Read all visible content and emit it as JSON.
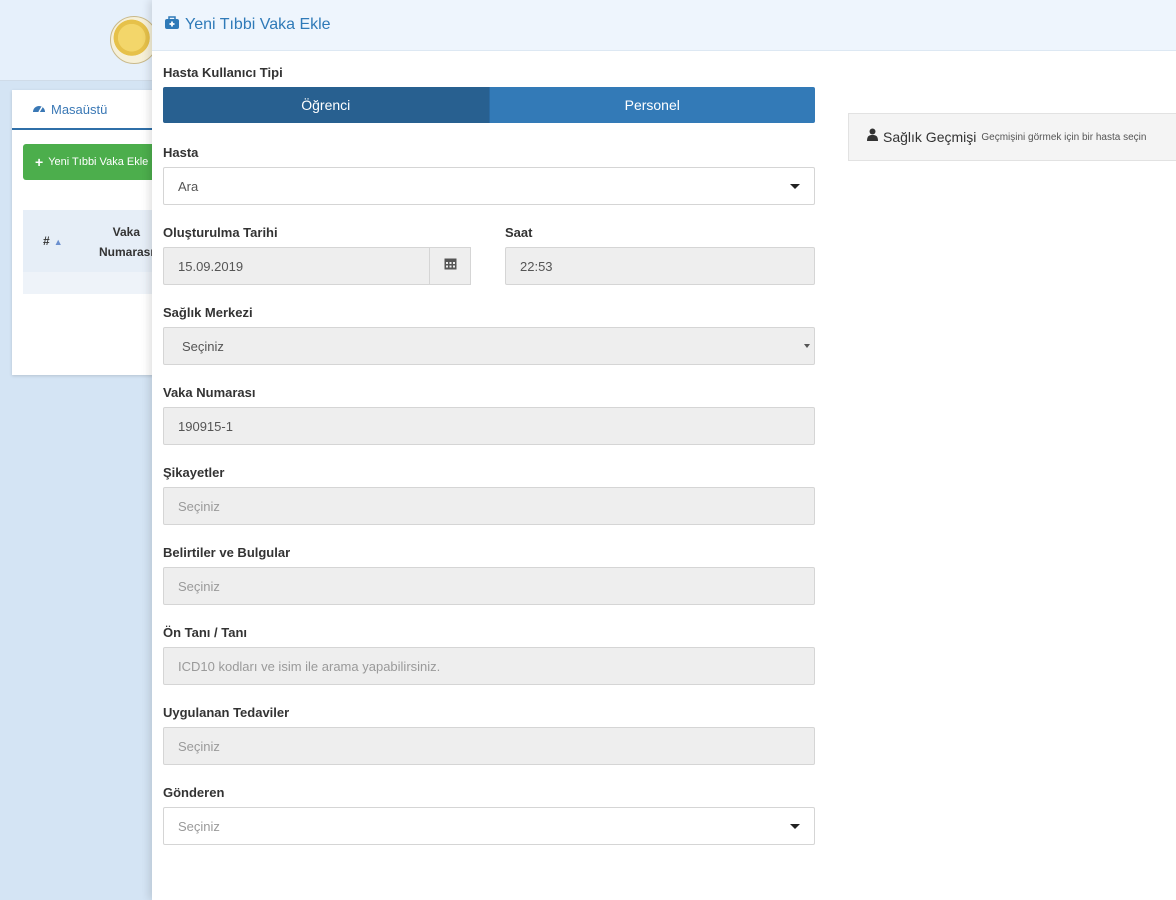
{
  "background": {
    "tab_label": "Masaüstü",
    "add_button_label": "Yeni Tıbbi Vaka Ekle",
    "table": {
      "col_hash": "#",
      "col_vaka_line1": "Vaka",
      "col_vaka_line2": "Numarası"
    }
  },
  "modal": {
    "title": "Yeni Tıbbi Vaka Ekle",
    "user_type": {
      "label": "Hasta Kullanıcı Tipi",
      "options": [
        "Öğrenci",
        "Personel"
      ],
      "selected": "Öğrenci"
    },
    "patient": {
      "label": "Hasta",
      "value": "Ara"
    },
    "created_date": {
      "label": "Oluşturulma Tarihi",
      "value": "15.09.2019"
    },
    "time": {
      "label": "Saat",
      "value": "22:53"
    },
    "health_center": {
      "label": "Sağlık Merkezi",
      "value": "Seçiniz"
    },
    "case_number": {
      "label": "Vaka Numarası",
      "value": "190915-1"
    },
    "complaints": {
      "label": "Şikayetler",
      "placeholder": "Seçiniz"
    },
    "symptoms": {
      "label": "Belirtiler ve Bulgular",
      "placeholder": "Seçiniz"
    },
    "diagnosis": {
      "label": "Ön Tanı / Tanı",
      "placeholder": "ICD10 kodları ve isim ile arama yapabilirsiniz."
    },
    "treatments": {
      "label": "Uygulanan Tedaviler",
      "placeholder": "Seçiniz"
    },
    "sender": {
      "label": "Gönderen",
      "value": "Seçiniz"
    },
    "history": {
      "title": "Sağlık Geçmişi",
      "hint": "Geçmişini görmek için bir hasta seçin"
    }
  },
  "colors": {
    "primary": "#337ab7",
    "primary_active": "#286090",
    "success": "#4cae4c",
    "header_text": "#2f7ab8"
  },
  "icons": [
    "dashboard-icon",
    "plus-icon",
    "medkit-icon",
    "calendar-icon",
    "user-icon",
    "sort-asc-icon",
    "chevron-down-icon"
  ]
}
